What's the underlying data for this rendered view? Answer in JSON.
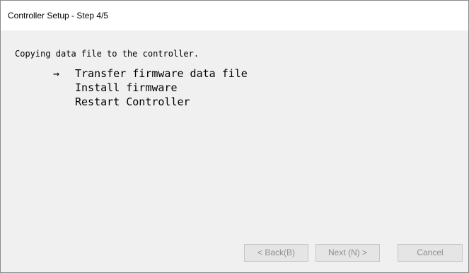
{
  "window": {
    "title": "Controller Setup - Step 4/5"
  },
  "content": {
    "intro": "Copying data file to the controller.",
    "current_marker": "→",
    "steps": [
      {
        "label": "Transfer firmware data file",
        "current": true
      },
      {
        "label": "Install firmware",
        "current": false
      },
      {
        "label": "Restart Controller",
        "current": false
      }
    ]
  },
  "buttons": {
    "back_label": "< Back(B)",
    "next_label": "Next (N) >",
    "cancel_label": "Cancel",
    "back_enabled": false,
    "next_enabled": false,
    "cancel_enabled": false
  },
  "colors": {
    "title_background": "#ffffff",
    "body_background": "#f0f0f0",
    "disabled_text": "#8e8e8e",
    "disabled_button_face": "#e5e5e5"
  }
}
